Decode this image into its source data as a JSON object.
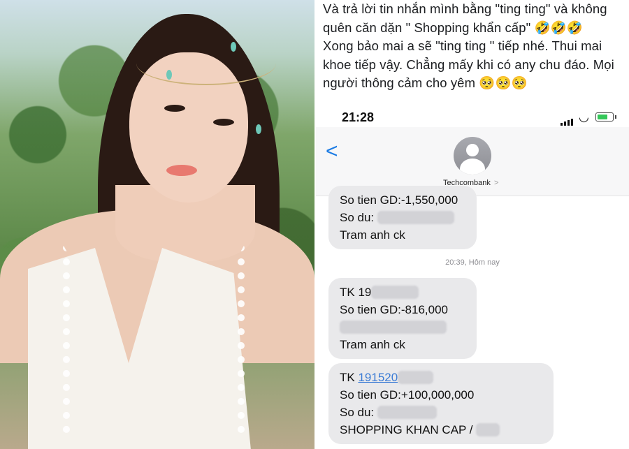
{
  "caption": {
    "lines": [
      "Và trả lời tin nhắn mình bằng \"ting ting\" và không",
      "quên căn dặn \" Shopping khẩn cấp\" 🤣🤣🤣",
      "Xong bảo mai a sẽ \"ting ting \" tiếp nhé. Thui mai",
      "khoe tiếp vậy. Chẳng mấy khi có any chu đáo. Mọi",
      "người thông cảm cho yêm 🥺🥺🥺"
    ]
  },
  "status_bar": {
    "time": "21:28",
    "icons": [
      "cellular-signal-icon",
      "wifi-icon",
      "battery-charging-icon"
    ]
  },
  "conversation": {
    "contact_name": "Techcombank",
    "contact_chevron": ">",
    "back_glyph": "<",
    "timestamp": "20:39, Hôm nay",
    "messages": [
      {
        "lines": [
          "So tien GD:-1,550,000",
          "So du:",
          "Tram anh ck"
        ]
      },
      {
        "account": "TK 19",
        "lines": [
          "So tien GD:-816,000",
          "Tram anh ck"
        ]
      },
      {
        "account": "TK 191520",
        "lines": [
          "So tien GD:+100,000,000",
          "So du:",
          "SHOPPING KHAN CAP /"
        ]
      }
    ]
  },
  "colors": {
    "bubble": "#e9e9eb",
    "link": "#3a7bd5",
    "back": "#1b7be4",
    "battery": "#34c759"
  }
}
